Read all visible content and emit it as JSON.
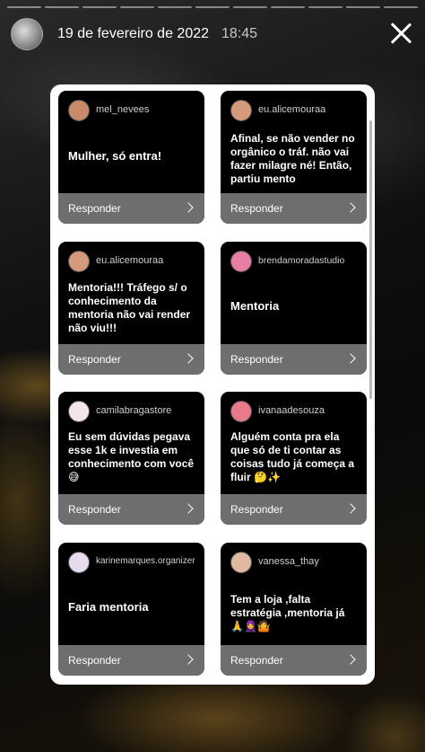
{
  "story": {
    "date": "19 de fevereiro de 2022",
    "time": "18:45",
    "segments": 11
  },
  "reply_label": "Responder",
  "cards": [
    {
      "username": "mel_nevees",
      "text": "Mulher, só entra!",
      "avatar_color": "#c98a6a"
    },
    {
      "username": "eu.alicemouraa",
      "text": "Afinal, se não vender no orgânico o tráf. não vai fazer milagre né! Então, partiu mento",
      "avatar_color": "#d49a7a"
    },
    {
      "username": "eu.alicemouraa",
      "text": "Mentoria!!! Tráfego s/ o conhecimento da mentoria não vai render não viu!!!",
      "avatar_color": "#d49a7a"
    },
    {
      "username": "brendamoradastudio",
      "text": "Mentoria",
      "avatar_color": "#e87ea5"
    },
    {
      "username": "camilabragastore",
      "text": "Eu sem dúvidas pegava esse 1k e investia em conhecimento com você 😅",
      "avatar_color": "#f3e6ea"
    },
    {
      "username": "ivanaadesouza",
      "text": "Alguém conta pra ela que só de ti contar as coisas tudo já começa a fluir 🤔✨",
      "avatar_color": "#e97a8a"
    },
    {
      "username": "karinemarques.organizer",
      "text": "Faria mentoria",
      "avatar_color": "#e6dbef"
    },
    {
      "username": "vanessa_thay",
      "text": "Tem a loja ,falta estratégia ,mentoria já 🙏🧕🤷",
      "avatar_color": "#e2b8a0"
    }
  ]
}
